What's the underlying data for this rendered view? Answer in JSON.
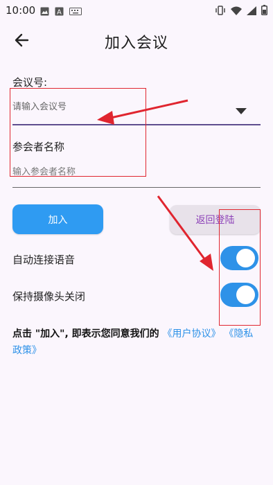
{
  "status_bar": {
    "time": "10:00",
    "left_icons": [
      "image-icon",
      "text-a-icon",
      "keyboard-icon"
    ],
    "right_icons": [
      "vibrate-icon",
      "wifi-icon",
      "signal-icon",
      "battery-icon"
    ]
  },
  "header": {
    "title": "加入会议"
  },
  "form": {
    "meeting_label": "会议号:",
    "meeting_placeholder": "请输入会议号",
    "name_label": "参会者名称",
    "name_placeholder": "输入参会者名称"
  },
  "buttons": {
    "join": "加入",
    "back_login": "返回登陆"
  },
  "toggles": [
    {
      "label": "自动连接语音",
      "on": true
    },
    {
      "label": "保持摄像头关闭",
      "on": true
    }
  ],
  "agreement": {
    "prefix": "点击 \"加入\", 即表示您同意我们的",
    "link1": "《用户协议》",
    "link2": "《隐私政策》"
  },
  "colors": {
    "accent": "#2F9BF2",
    "background": "#FBF6FD",
    "annotation_red": "#E0252F",
    "secondary_text": "#8D43B8"
  }
}
